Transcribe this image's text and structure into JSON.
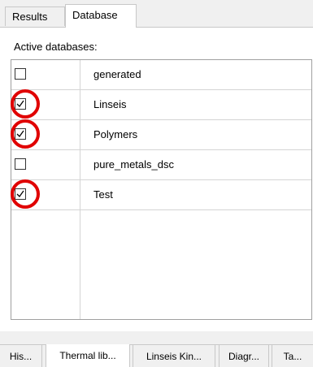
{
  "top_tabs": [
    {
      "label": "Results",
      "active": false
    },
    {
      "label": "Database",
      "active": true
    }
  ],
  "panel": {
    "label": "Active databases:"
  },
  "databases": [
    {
      "name": "generated",
      "checked": false,
      "highlighted": false
    },
    {
      "name": "Linseis",
      "checked": true,
      "highlighted": true
    },
    {
      "name": "Polymers",
      "checked": true,
      "highlighted": true
    },
    {
      "name": "pure_metals_dsc",
      "checked": false,
      "highlighted": false
    },
    {
      "name": "Test",
      "checked": true,
      "highlighted": true
    }
  ],
  "bottom_tabs": [
    {
      "label": "His...",
      "active": false
    },
    {
      "label": "Thermal lib...",
      "active": true
    },
    {
      "label": "Linseis Kin...",
      "active": false
    },
    {
      "label": "Diagr...",
      "active": false
    },
    {
      "label": "Ta...",
      "active": false
    }
  ],
  "colors": {
    "highlight": "#e00000",
    "check": "#000000"
  }
}
